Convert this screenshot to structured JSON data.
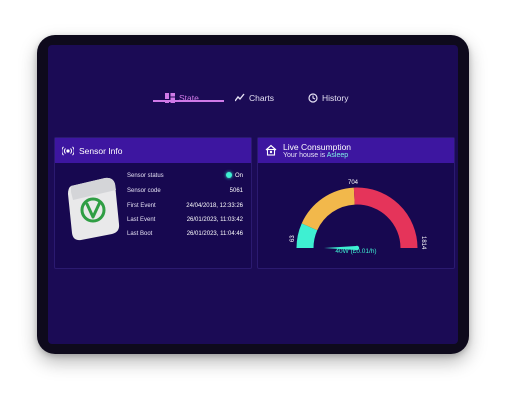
{
  "tabs": [
    {
      "label": "State",
      "icon": "dashboard-grid-icon",
      "active": true
    },
    {
      "label": "Charts",
      "icon": "line-chart-icon",
      "active": false
    },
    {
      "label": "History",
      "icon": "history-clock-icon",
      "active": false
    }
  ],
  "sensor_info": {
    "title": "Sensor Info",
    "icon": "sensor-waves-icon",
    "rows": [
      {
        "label": "Sensor status",
        "value": "On"
      },
      {
        "label": "Sensor code",
        "value": "5061"
      },
      {
        "label": "First Event",
        "value": "24/04/2018, 12:33:26"
      },
      {
        "label": "Last Event",
        "value": "26/01/2023, 11:03:42"
      },
      {
        "label": "Last Boot",
        "value": "26/01/2023, 11:04:46"
      }
    ]
  },
  "live_consumption": {
    "title": "Live Consumption",
    "subtitle_prefix": "Your house is ",
    "house_state": "Asleep",
    "icon": "house-icon",
    "gauge": {
      "min_label": "63",
      "mid_label": "704",
      "max_label": "1814",
      "reading": "40W (£0.01/h)",
      "colors": {
        "low": "#3ef0d2",
        "mid": "#f2b84b",
        "high": "#e5345a"
      }
    }
  },
  "colors": {
    "background": "#1b0b55",
    "panel_header": "#3d16a0",
    "accent": "#d07ae8"
  }
}
